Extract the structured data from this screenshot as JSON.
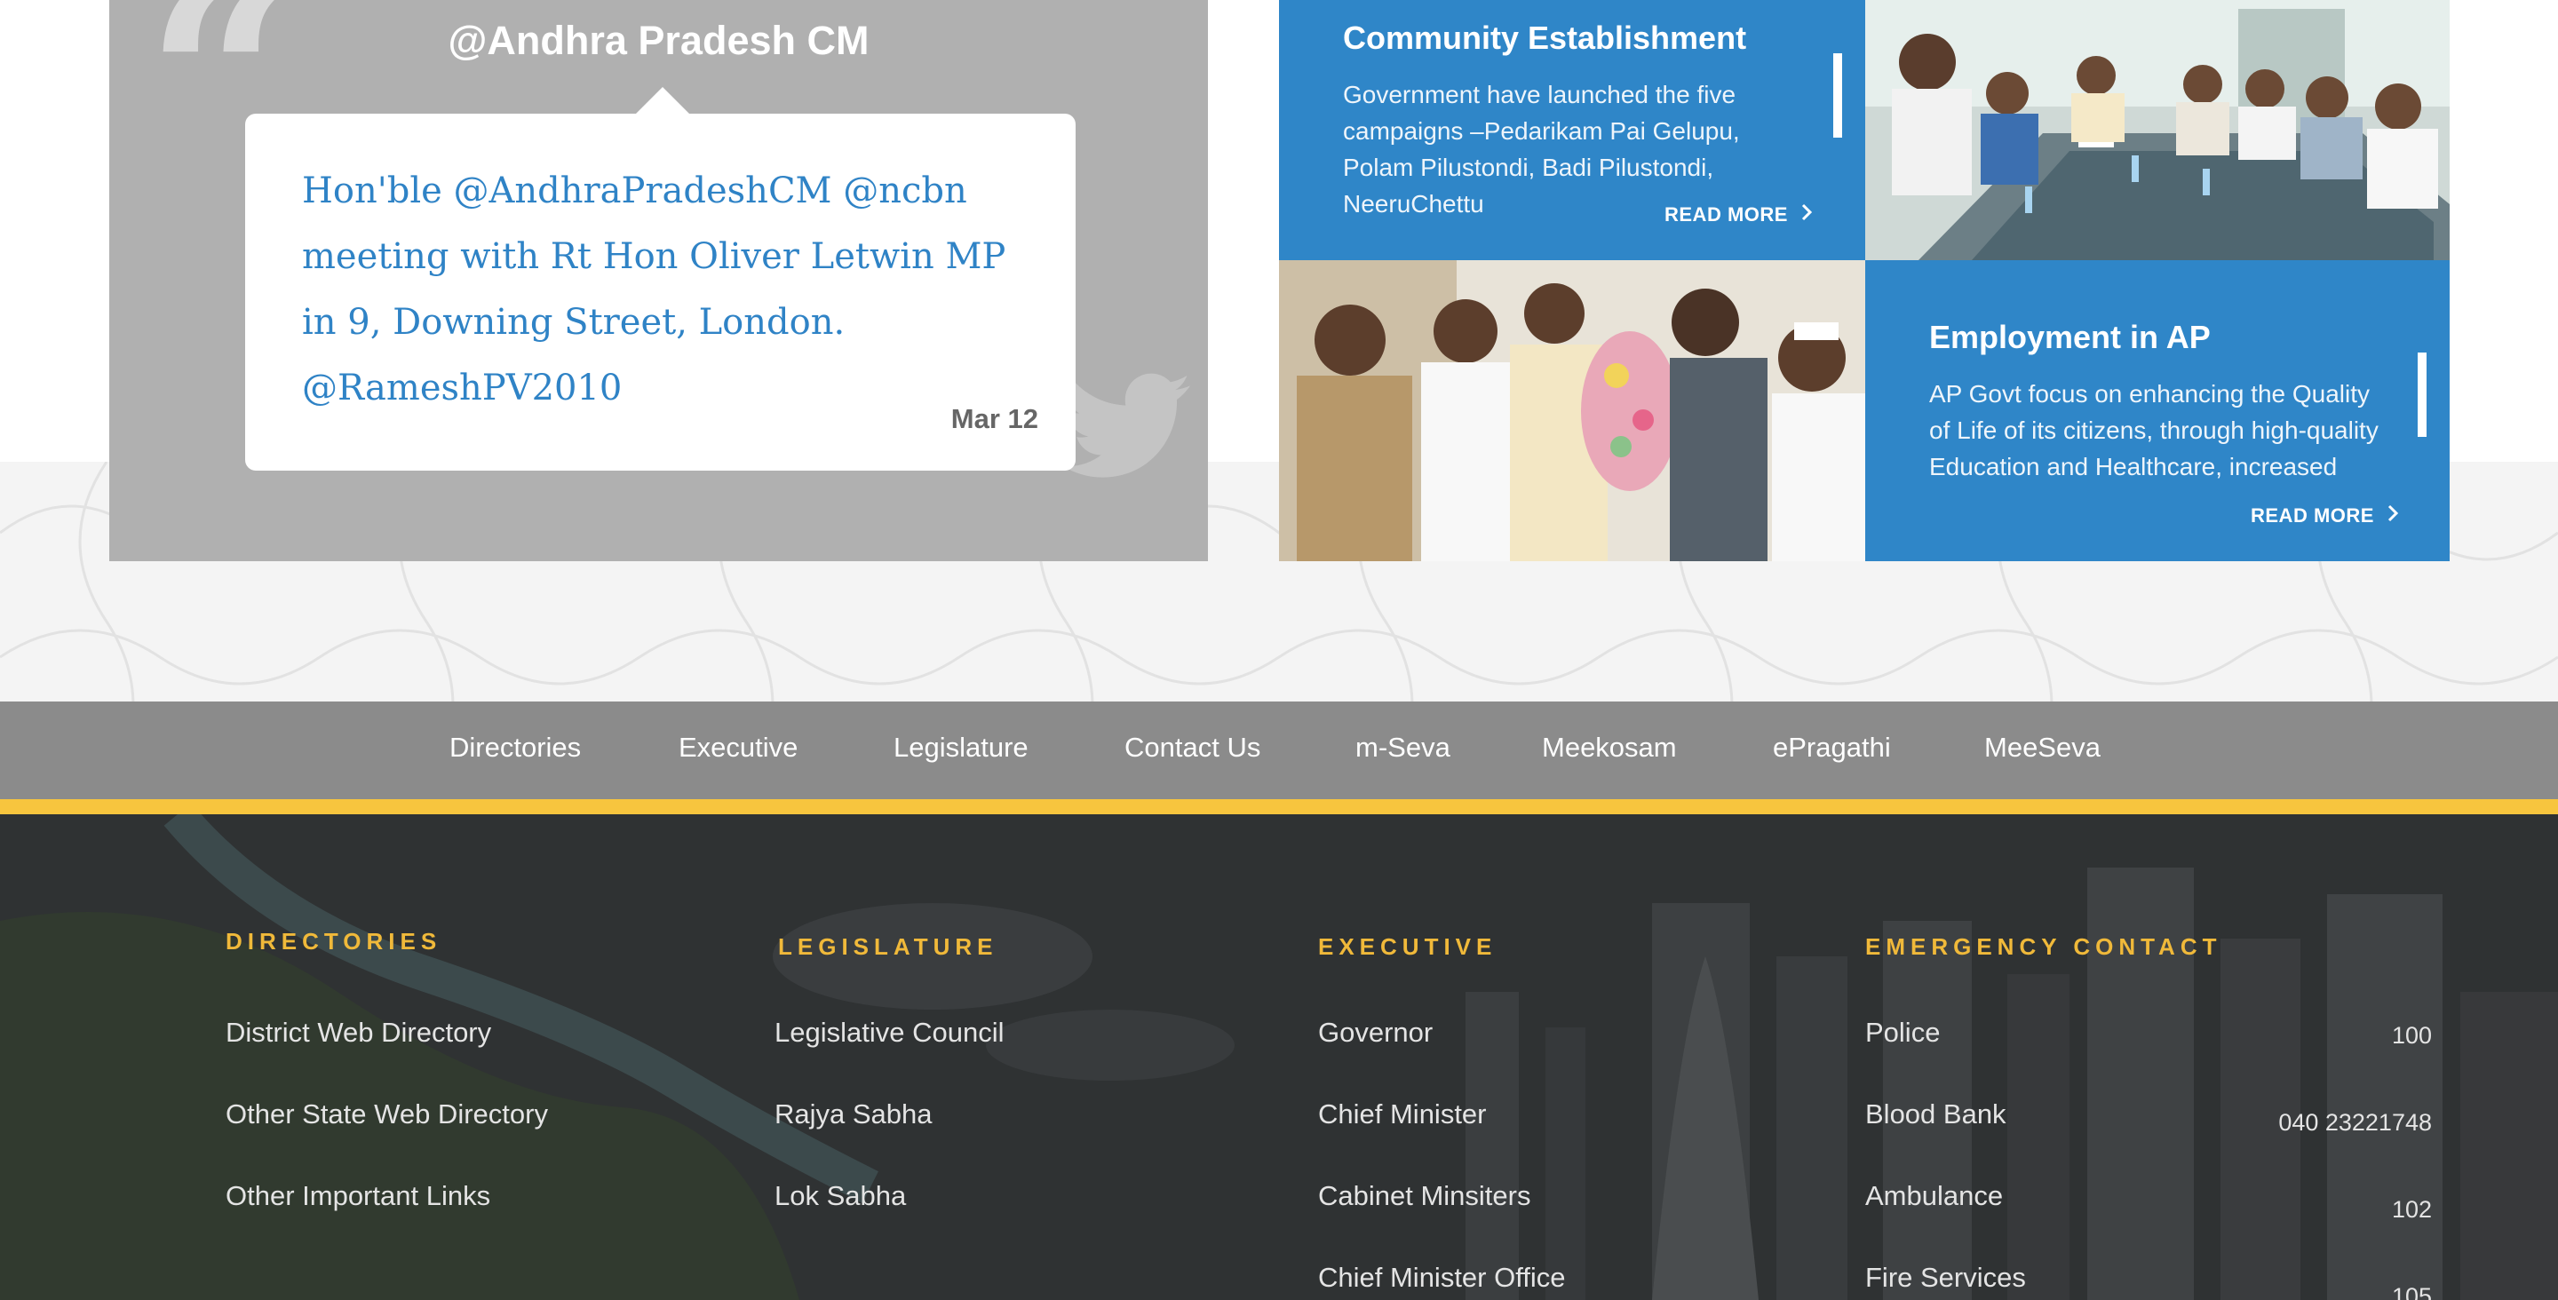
{
  "tweet": {
    "handle": "@Andhra Pradesh CM",
    "text": "Hon'ble @AndhraPradeshCM @ncbn meeting with Rt Hon Oliver Letwin MP in 9, Downing Street, London. @RameshPV2010",
    "date": "Mar 12"
  },
  "tiles": [
    {
      "title": "Community Establishment",
      "description": "Government have launched the five campaigns –Pedarikam Pai Gelupu, Polam Pilustondi, Badi Pilustondi, NeeruChettu",
      "read_more": "READ MORE"
    },
    {
      "title": "Employment in AP",
      "description": "AP Govt focus on enhancing the Quality of Life of its citizens, through high-quality Education and Healthcare, increased",
      "read_more": "READ MORE"
    }
  ],
  "nav": {
    "items": [
      "Directories",
      "Executive",
      "Legislature",
      "Contact Us",
      "m-Seva",
      "Meekosam",
      "ePragathi",
      "MeeSeva"
    ]
  },
  "footer": {
    "directories": {
      "heading": "DIRECTORIES",
      "links": [
        "District Web Directory",
        "Other State Web Directory",
        "Other Important Links"
      ]
    },
    "legislature": {
      "heading": "LEGISLATURE",
      "links": [
        "Legislative Council",
        "Rajya Sabha",
        "Lok Sabha"
      ]
    },
    "executive": {
      "heading": "EXECUTIVE",
      "links": [
        "Governor",
        "Chief Minister",
        "Cabinet Minsiters",
        "Chief Minister Office"
      ]
    },
    "emergency": {
      "heading": "EMERGENCY CONTACT",
      "contacts": [
        {
          "label": "Police",
          "number": "100"
        },
        {
          "label": "Blood Bank",
          "number": "040 23221748"
        },
        {
          "label": "Ambulance",
          "number": "102"
        },
        {
          "label": "Fire Services",
          "number": "105"
        }
      ]
    }
  },
  "colors": {
    "tile_blue": "#2f86c8",
    "tweet_text": "#2f83c6",
    "accent_gold": "#f7c53e",
    "footer_heading": "#f0b93a",
    "nav_bg": "#8b8b8b"
  },
  "icons": [
    "quote-icon",
    "twitter-bird-icon",
    "chevron-right-icon"
  ]
}
